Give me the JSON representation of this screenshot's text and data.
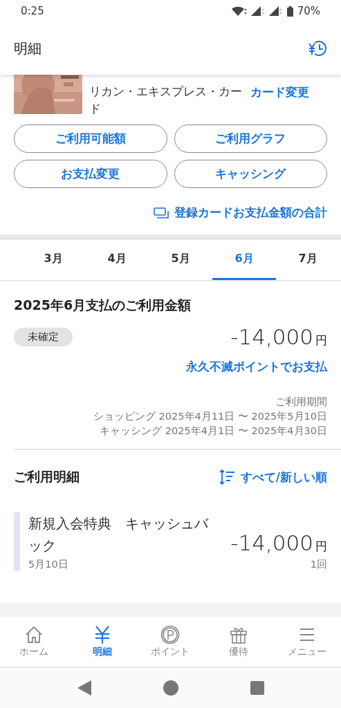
{
  "status_bar": {
    "time": "0:25",
    "battery": "70%"
  },
  "header": {
    "title": "明細"
  },
  "card": {
    "kind": "picture",
    "name": "リカン・エキスプレス・カード",
    "change_link": "カード変更"
  },
  "action_buttons": [
    "ご利用可能額",
    "ご利用グラフ",
    "お支払変更",
    "キャッシング"
  ],
  "total_link": "登録カードお支払金額の合計",
  "month_tabs": [
    {
      "label": "3月",
      "selected": false
    },
    {
      "label": "4月",
      "selected": false
    },
    {
      "label": "5月",
      "selected": false
    },
    {
      "label": "6月",
      "selected": true
    },
    {
      "label": "7月",
      "selected": false
    }
  ],
  "summary": {
    "title": "2025年6月支払のご利用金額",
    "status_badge": "未確定",
    "amount": "-14,000",
    "currency": "円",
    "points_link": "永久不滅ポイントでお支払",
    "period_label": "ご利用期間",
    "periods": [
      "ショッピング 2025年4月11日 〜 2025年5月10日",
      "キャッシング 2025年4月1日 〜 2025年4月30日"
    ]
  },
  "details": {
    "title": "ご利用明細",
    "sort_link": "すべて/新しい順",
    "items": [
      {
        "title": "新規入会特典　キャッシュバック",
        "date": "5月10日",
        "amount": "-14,000",
        "currency": "円",
        "installments": "1回"
      }
    ]
  },
  "bottom_nav": [
    {
      "label": "ホーム",
      "kind": "home",
      "selected": false
    },
    {
      "label": "明細",
      "kind": "yen",
      "selected": true
    },
    {
      "label": "ポイント",
      "kind": "point",
      "selected": false
    },
    {
      "label": "優待",
      "kind": "gift",
      "selected": false
    },
    {
      "label": "メニュー",
      "kind": "menu",
      "selected": false
    }
  ]
}
